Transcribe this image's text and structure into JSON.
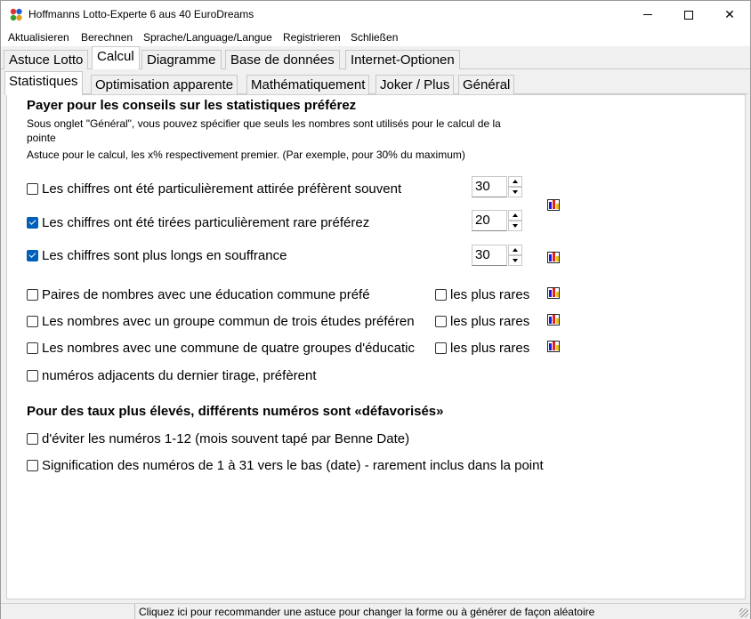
{
  "window": {
    "title": "Hoffmanns Lotto-Experte  6 aus 40 EuroDreams",
    "minimize_glyph": "",
    "close_glyph": "✕"
  },
  "menu": [
    "Aktualisieren",
    "Berechnen",
    "Sprache/Language/Langue",
    "Registrieren",
    "Schließen"
  ],
  "tabs": [
    "Astuce Lotto",
    "Calcul",
    "Diagramme",
    "Base de données",
    "Internet-Optionen"
  ],
  "active_tab": 1,
  "subtabs": [
    "Statistiques",
    "Optimisation apparente",
    "Mathématiquement",
    "Joker / Plus",
    "Général"
  ],
  "active_subtab": 0,
  "section1": {
    "heading": "Payer pour les conseils sur les statistiques préférez",
    "desc_line1": "Sous onglet \"Général\", vous pouvez spécifier que seuls les nombres sont utilisés pour le calcul de la",
    "desc_line2": "pointe",
    "desc_line3": "Astuce pour le calcul, les x% respectivement premier. (Par exemple, pour 30% du maximum)"
  },
  "spin_rows": [
    {
      "label": "Les chiffres ont été particulièrement attirée préfèrent souvent",
      "checked": false,
      "value": "30"
    },
    {
      "label": "Les chiffres ont été tirées particulièrement rare préférez",
      "checked": true,
      "value": "20"
    },
    {
      "label": "Les chiffres sont plus longs en souffrance",
      "checked": true,
      "value": "30"
    }
  ],
  "group_rows": [
    {
      "label": "Paires de nombres avec une éducation commune préfé",
      "checked": false,
      "rare_label": "les plus rares",
      "rare_checked": false
    },
    {
      "label": "Les nombres avec un groupe commun de trois études préféren",
      "checked": false,
      "rare_label": "les plus rares",
      "rare_checked": false
    },
    {
      "label": "Les nombres avec une commune de quatre groupes d'éducatic",
      "checked": false,
      "rare_label": "les plus rares",
      "rare_checked": false
    }
  ],
  "adjacent_row": {
    "label": "numéros adjacents du dernier tirage, préfèrent",
    "checked": false
  },
  "section2": {
    "heading": "Pour des taux plus élevés, différents numéros sont «défavorisés»",
    "rows": [
      {
        "label": "d'éviter les numéros 1-12 (mois souvent tapé par Benne Date)",
        "checked": false
      },
      {
        "label": "Signification des numéros de 1 à 31 vers le bas (date) - rarement inclus dans la point",
        "checked": false
      }
    ]
  },
  "status": {
    "text": "Cliquez ici pour recommander une astuce pour changer la forme ou à générer de façon aléatoire"
  },
  "icons": {
    "app": "lotto-app-icon",
    "chart": "bar-chart-icon"
  },
  "colors": {
    "checkbox_checked": "#005fb8",
    "chart_blue": "#1a1ae6",
    "chart_red": "#e62020",
    "chart_yellow": "#e6c41a"
  }
}
